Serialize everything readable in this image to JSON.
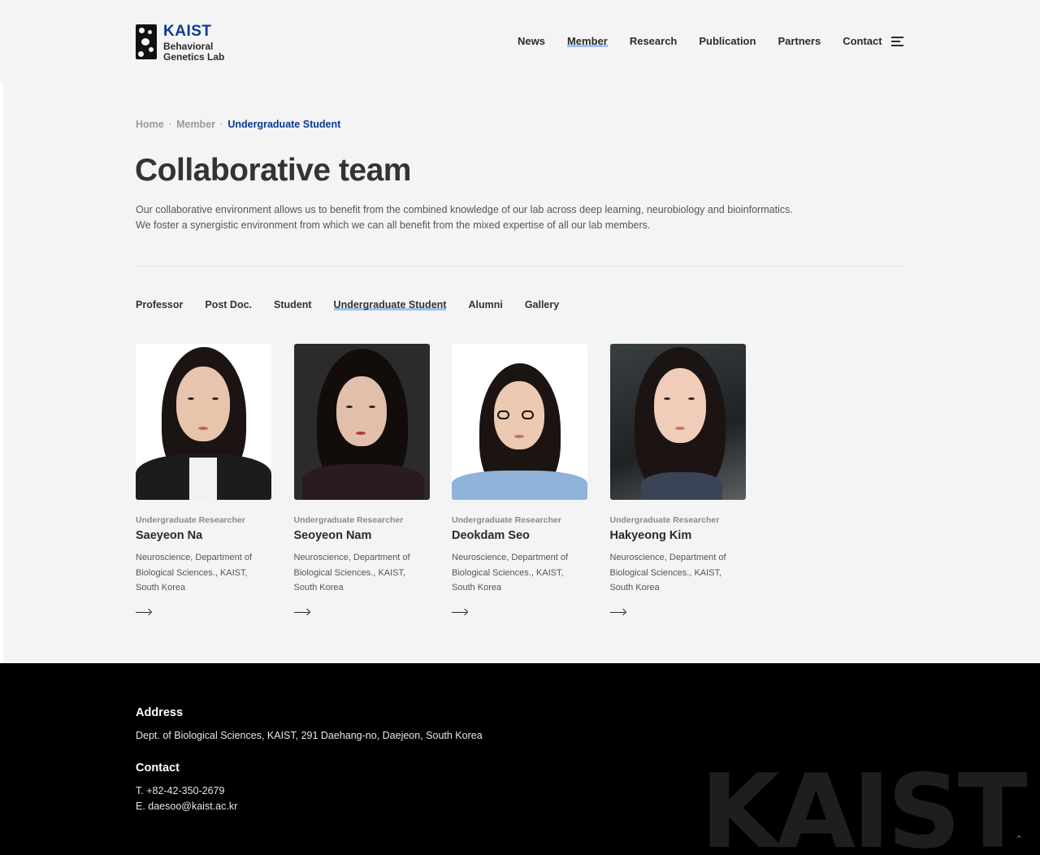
{
  "header": {
    "logo": {
      "title": "KAIST",
      "subtitle_line1": "Behavioral",
      "subtitle_line2": "Genetics Lab"
    },
    "nav": [
      "News",
      "Member",
      "Research",
      "Publication",
      "Partners",
      "Contact"
    ],
    "active_nav": "Member",
    "menu_icon": "hamburger-icon"
  },
  "breadcrumb": {
    "home": "Home",
    "section": "Member",
    "current": "Undergraduate Student"
  },
  "page": {
    "title": "Collaborative team",
    "description_line1": "Our collaborative environment allows us to benefit from the combined knowledge of our lab across deep learning, neurobiology and bioinformatics.",
    "description_line2": "We foster a synergistic environment from which we can all benefit from the mixed expertise of all our lab members."
  },
  "tabs": [
    "Professor",
    "Post Doc.",
    "Student",
    "Undergraduate Student",
    "Alumni",
    "Gallery"
  ],
  "active_tab": "Undergraduate Student",
  "members": [
    {
      "role": "Undergraduate Researcher",
      "name": "Saeyeon Na",
      "affil_line1": "Neuroscience, Department of",
      "affil_line2": "Biological Sciences., KAIST,",
      "affil_line3": "South Korea"
    },
    {
      "role": "Undergraduate Researcher",
      "name": "Seoyeon Nam",
      "affil_line1": "Neuroscience, Department of",
      "affil_line2": "Biological Sciences., KAIST,",
      "affil_line3": "South Korea"
    },
    {
      "role": "Undergraduate Researcher",
      "name": "Deokdam Seo",
      "affil_line1": "Neuroscience, Department of",
      "affil_line2": "Biological Sciences., KAIST,",
      "affil_line3": "South Korea"
    },
    {
      "role": "Undergraduate Researcher",
      "name": "Hakyeong Kim",
      "affil_line1": "Neuroscience, Department of",
      "affil_line2": "Biological Sciences., KAIST,",
      "affil_line3": "South Korea"
    }
  ],
  "footer": {
    "address_heading": "Address",
    "address": "Dept. of Biological Sciences, KAIST, 291 Daehang-no, Daejeon, South Korea",
    "contact_heading": "Contact",
    "phone": "T. +82-42-350-2679",
    "email": "E. daesoo@kaist.ac.kr",
    "wordmark": "KAIST",
    "top_button": "^"
  },
  "colors": {
    "accent": "#0a3a91",
    "underline": "#9fc0ee",
    "page_bg": "#f4f4f4",
    "footer_bg": "#000000"
  }
}
